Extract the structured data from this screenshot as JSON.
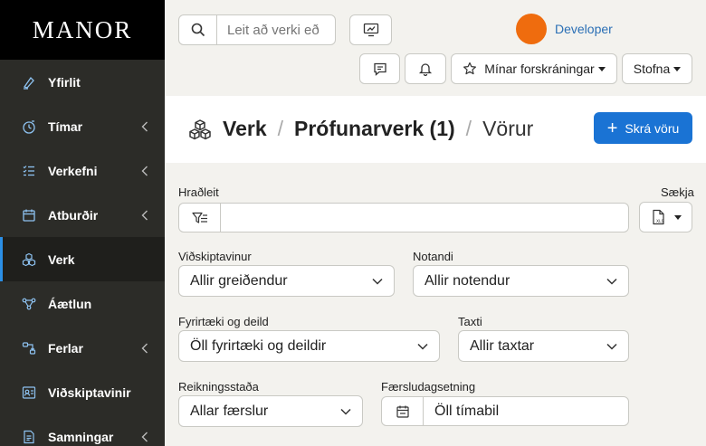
{
  "sidebar": {
    "logo": "MANOR",
    "items": [
      {
        "label": "Yfirlit",
        "icon": "pen-tool-icon",
        "chevron": false,
        "active": false
      },
      {
        "label": "Tímar",
        "icon": "timer-icon",
        "chevron": true,
        "active": false
      },
      {
        "label": "Verkefni",
        "icon": "task-list-icon",
        "chevron": true,
        "active": false
      },
      {
        "label": "Atburðir",
        "icon": "calendar-icon",
        "chevron": true,
        "active": false
      },
      {
        "label": "Verk",
        "icon": "cubes-icon",
        "chevron": false,
        "active": true
      },
      {
        "label": "Áætlun",
        "icon": "plan-network-icon",
        "chevron": false,
        "active": false
      },
      {
        "label": "Ferlar",
        "icon": "flow-icon",
        "chevron": true,
        "active": false
      },
      {
        "label": "Viðskiptavinir",
        "icon": "customers-icon",
        "chevron": false,
        "active": false
      },
      {
        "label": "Samningar",
        "icon": "contract-icon",
        "chevron": true,
        "active": false
      }
    ]
  },
  "header": {
    "search_placeholder": "Leit að verki eð",
    "username": "Developer",
    "bookmarks_label": "Mínar forskráningar",
    "create_label": "Stofna"
  },
  "page": {
    "breadcrumb": [
      "Verk",
      "Prófunarverk (1)"
    ],
    "current": "Vörur",
    "primary_button": "Skrá vöru"
  },
  "filters": {
    "quicksearch_label": "Hraðleit",
    "export_label": "Sækja",
    "customer_label": "Viðskiptavinur",
    "customer_value": "Allir greiðendur",
    "user_label": "Notandi",
    "user_value": "Allir notendur",
    "company_label": "Fyrirtæki og deild",
    "company_value": "Öll fyrirtæki og deildir",
    "rate_label": "Taxti",
    "rate_value": "Allir taxtar",
    "billing_label": "Reikningsstaða",
    "billing_value": "Allar færslur",
    "date_label": "Færsludagsetning",
    "date_value": "Öll tímabil"
  },
  "colors": {
    "sidebar_bg": "#2c2c28",
    "accent": "#1a73d4",
    "avatar": "#ef6c0e",
    "username": "#2a6fb5"
  }
}
